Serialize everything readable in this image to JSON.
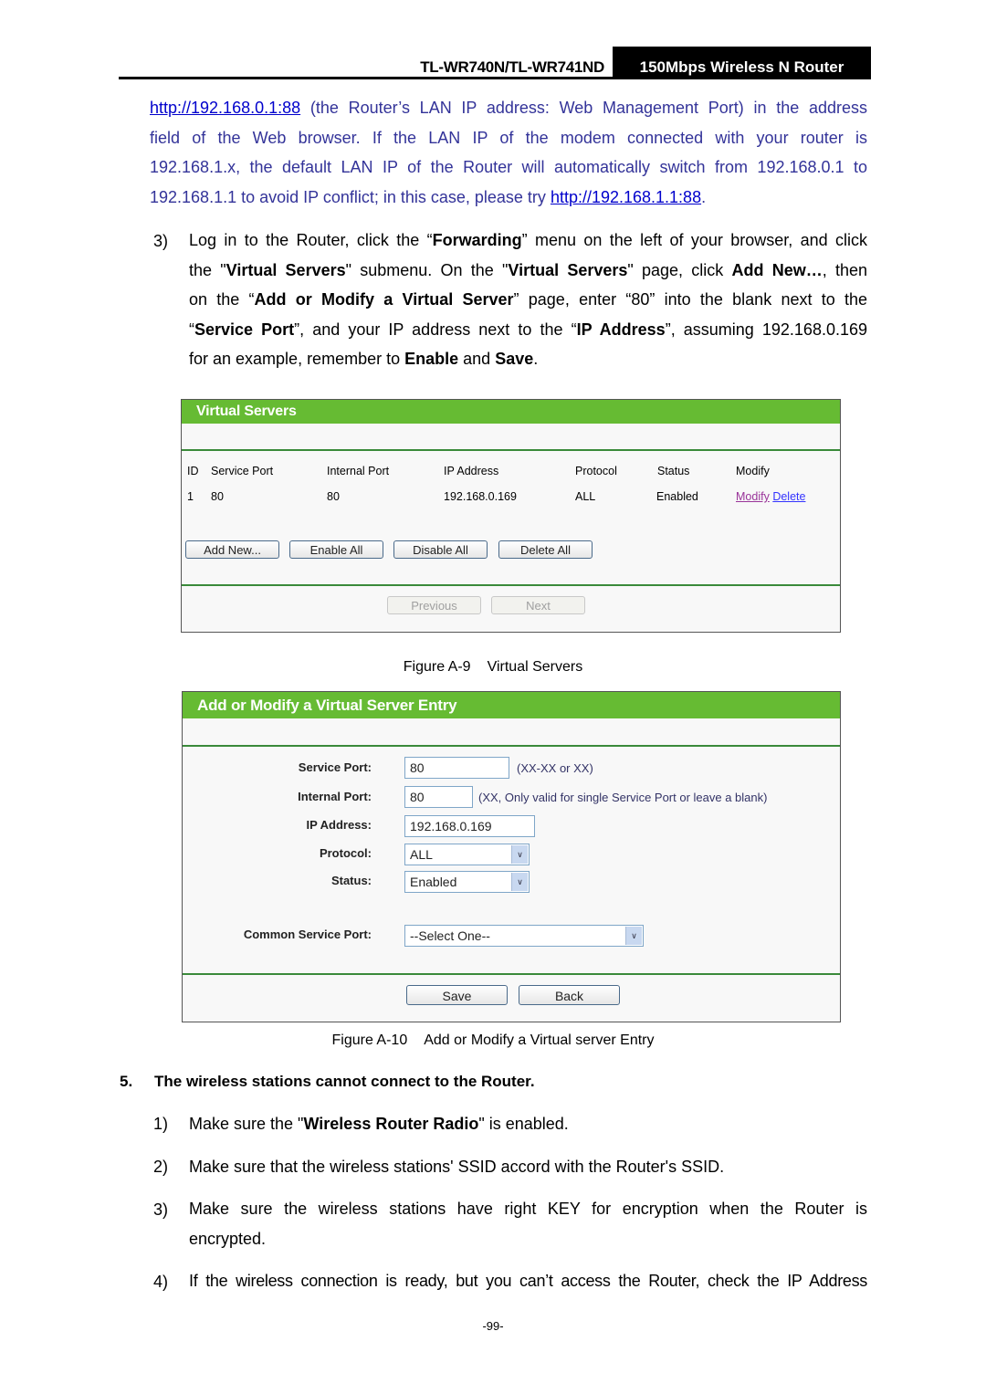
{
  "header": {
    "model": "TL-WR740N/TL-WR741ND",
    "product": "150Mbps Wireless N Router"
  },
  "intro": {
    "link1": "http://192.168.0.1:88",
    "line1_rest": " (the Router’s LAN IP address: Web Management Port) in the address",
    "line2": "field of the Web browser. If the LAN IP of the modem connected with your router is",
    "line3": "192.168.1.x, the default LAN IP of the Router will automatically switch from 192.168.0.1 to",
    "line4_pre": "192.168.1.1 to avoid IP conflict; in this case, please try ",
    "link2": "http://192.168.1.1:88",
    "line4_post": "."
  },
  "step3": {
    "number": "3)",
    "t1": "Log in to the Router, click the “",
    "b1": "Forwarding",
    "t2": "” menu on the left of your browser, and click",
    "t3": "the \"",
    "b2": "Virtual Servers",
    "t4": "\" submenu. On the \"",
    "b3": "Virtual Servers",
    "t5": "\" page, click ",
    "b4": "Add New…",
    "t6": ", then",
    "t7": "on the “",
    "b5": "Add or Modify a Virtual Server",
    "t8": "” page, enter “80” into the blank next to the",
    "t9": "“",
    "b6": "Service Port",
    "t10": "”, and your IP address next to the “",
    "b7": "IP Address",
    "t11": "”, assuming 192.168.0.169",
    "t12": "for an example, remember to ",
    "b8": "Enable",
    "t13": " and ",
    "b9": "Save",
    "t14": "."
  },
  "virtual_servers": {
    "title": "Virtual Servers",
    "columns": [
      "ID",
      "Service Port",
      "Internal Port",
      "IP Address",
      "Protocol",
      "Status",
      "Modify"
    ],
    "rows": [
      {
        "id": "1",
        "service_port": "80",
        "internal_port": "80",
        "ip": "192.168.0.169",
        "protocol": "ALL",
        "status": "Enabled",
        "modify": "Modify",
        "delete": "Delete"
      }
    ],
    "buttons": {
      "add_new": "Add New...",
      "enable_all": "Enable All",
      "disable_all": "Disable All",
      "delete_all": "Delete All",
      "previous": "Previous",
      "next": "Next"
    },
    "colors": {
      "header_green": "#66bb33",
      "rule_green": "#3a8a3a"
    }
  },
  "figure_a9": {
    "label": "Figure A-9",
    "title": "Virtual Servers"
  },
  "entry_form": {
    "title": "Add or Modify a Virtual Server Entry",
    "service_port": {
      "label": "Service Port:",
      "value": "80",
      "hint": "(XX-XX or XX)"
    },
    "internal_port": {
      "label": "Internal Port:",
      "value": "80",
      "hint": "(XX, Only valid for single Service Port or leave a blank)"
    },
    "ip_address": {
      "label": "IP Address:",
      "value": "192.168.0.169"
    },
    "protocol": {
      "label": "Protocol:",
      "selected": "ALL"
    },
    "status": {
      "label": "Status:",
      "selected": "Enabled"
    },
    "common_service_port": {
      "label": "Common Service Port:",
      "selected": "--Select One--"
    },
    "buttons": {
      "save": "Save",
      "back": "Back"
    }
  },
  "figure_a10": {
    "label": "Figure A-10",
    "title": "Add or Modify a Virtual server Entry"
  },
  "section5": {
    "number": "5.",
    "heading": "The wireless stations cannot connect to the Router.",
    "items": [
      {
        "number": "1)",
        "pre": "Make sure the \"",
        "bold": "Wireless Router Radio",
        "post": "\" is enabled."
      },
      {
        "number": "2)",
        "text": "Make sure that the wireless stations' SSID accord with the Router's SSID."
      },
      {
        "number": "3)",
        "line1": "Make sure the wireless stations have right KEY for encryption when the Router is",
        "line2": "encrypted."
      },
      {
        "number": "4)",
        "text": "If the wireless connection is ready, but you can’t access the Router, check the IP Address"
      }
    ]
  },
  "footer": {
    "page": "-99-"
  }
}
